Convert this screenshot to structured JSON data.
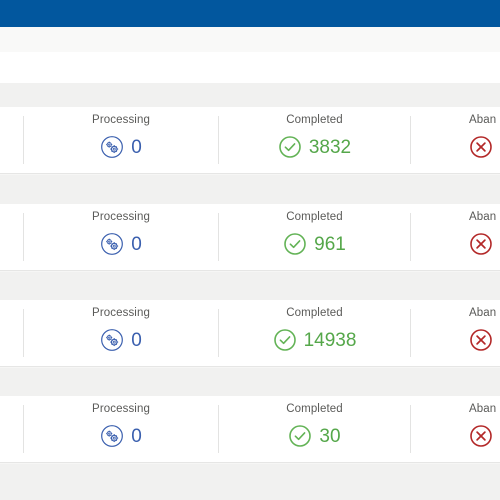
{
  "window": {
    "header_color": "#02579e",
    "page_background": "#f1f1f0",
    "card_background": "#ffffff"
  },
  "colors": {
    "processing": "#3a5fae",
    "completed": "#55a74a",
    "abandoned": "#b32828",
    "label": "#5a5a58",
    "divider": "#e3e3e2"
  },
  "columns": {
    "processing_label": "Processing",
    "completed_label": "Completed",
    "abandoned_label": "Aban",
    "processing_icon": "gears-circle-icon",
    "completed_icon": "check-circle-icon",
    "abandoned_icon": "x-circle-icon"
  },
  "cards": [
    {
      "processing_label": "Processing",
      "processing_value": "0",
      "completed_label": "Completed",
      "completed_value": "3832",
      "abandoned_label": "Aban",
      "abandoned_value": ""
    },
    {
      "processing_label": "Processing",
      "processing_value": "0",
      "completed_label": "Completed",
      "completed_value": "961",
      "abandoned_label": "Aban",
      "abandoned_value": ""
    },
    {
      "processing_label": "Processing",
      "processing_value": "0",
      "completed_label": "Completed",
      "completed_value": "14938",
      "abandoned_label": "Aban",
      "abandoned_value": ""
    },
    {
      "processing_label": "Processing",
      "processing_value": "0",
      "completed_label": "Completed",
      "completed_value": "30",
      "abandoned_label": "Aban",
      "abandoned_value": ""
    }
  ]
}
